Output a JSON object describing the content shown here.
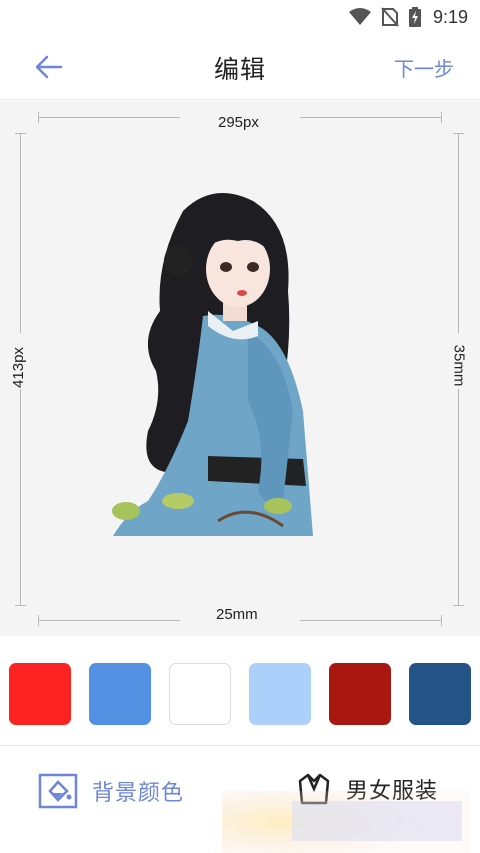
{
  "status_bar": {
    "time": "9:19",
    "icons": [
      "wifi-icon",
      "no-sim-icon",
      "battery-charging-icon"
    ]
  },
  "header": {
    "title": "编辑",
    "next_label": "下一步",
    "back_icon": "arrow-left-icon"
  },
  "preview": {
    "width_px_label": "295px",
    "height_px_label": "413px",
    "width_mm_label": "25mm",
    "height_mm_label": "35mm"
  },
  "swatches": [
    {
      "name": "red",
      "color": "#fd2320"
    },
    {
      "name": "blue",
      "color": "#5290e1"
    },
    {
      "name": "white",
      "color": "#ffffff"
    },
    {
      "name": "light-blue",
      "color": "#add0fb"
    },
    {
      "name": "dark-red",
      "color": "#a81710"
    },
    {
      "name": "navy",
      "color": "#245388"
    }
  ],
  "tools": {
    "background_color_label": "背景颜色",
    "clothes_label": "男女服装"
  },
  "colors": {
    "accent": "#6e86d8"
  }
}
